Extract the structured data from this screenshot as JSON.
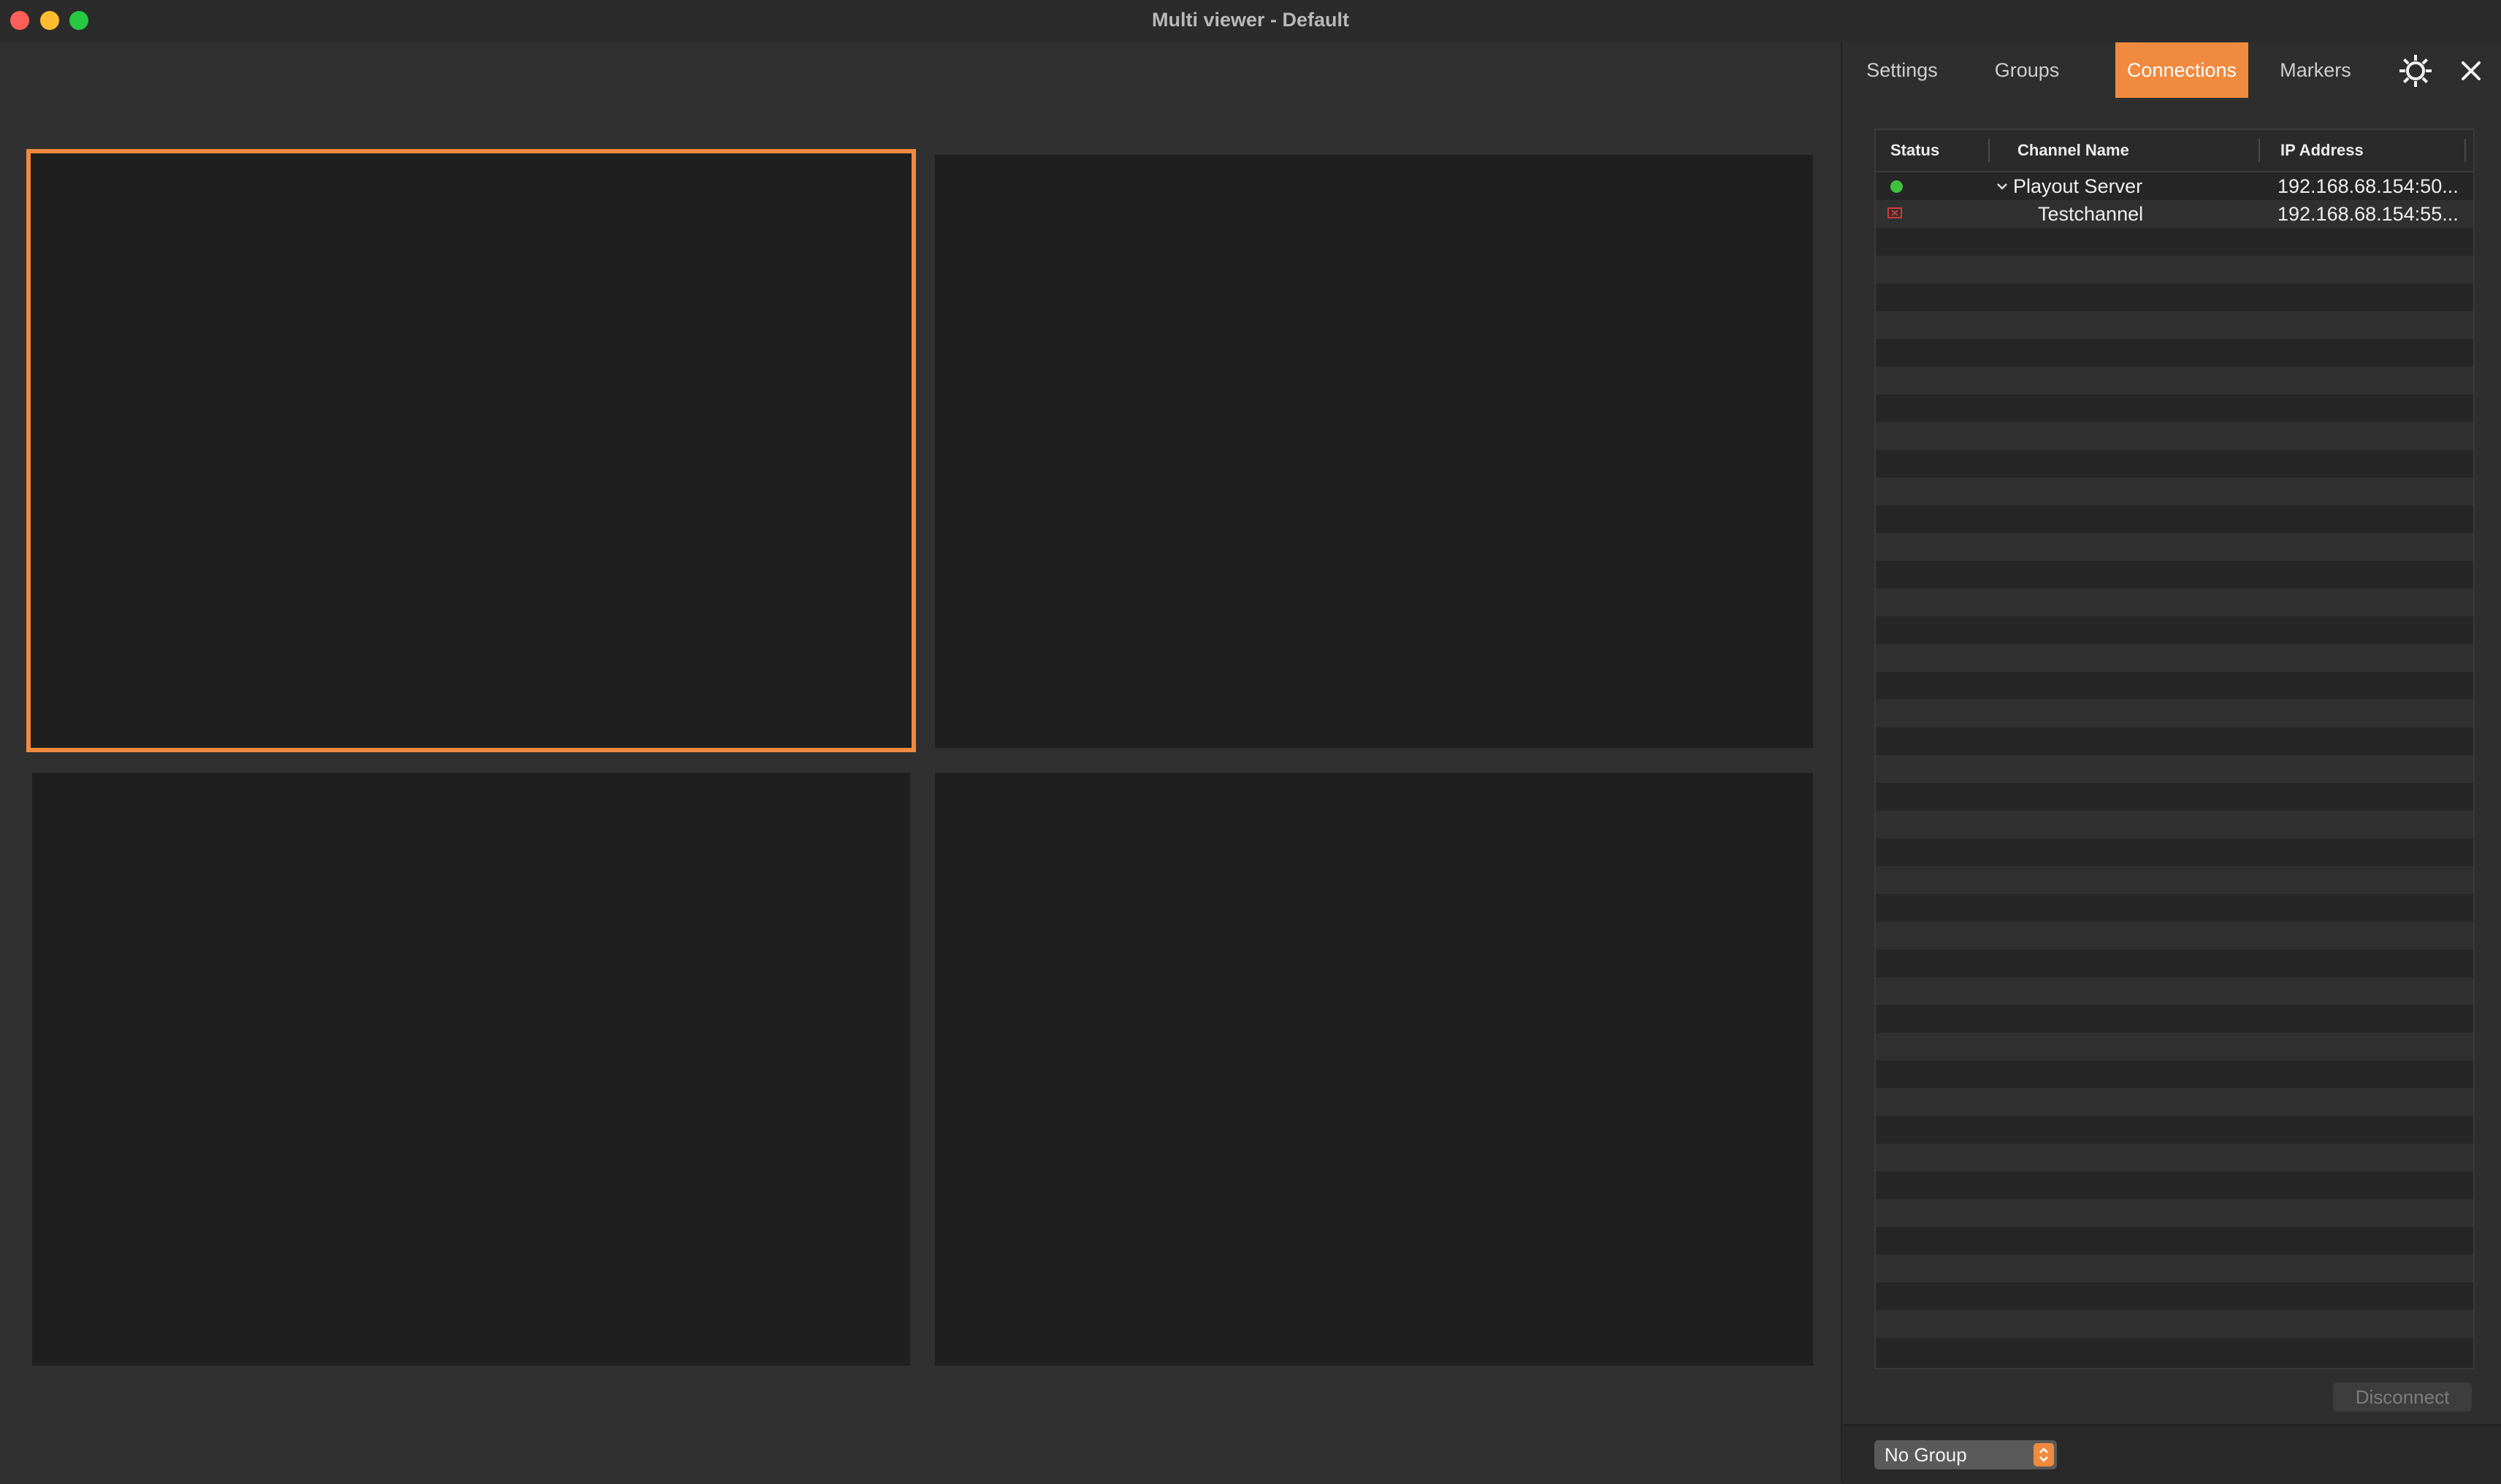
{
  "window": {
    "title": "Multi viewer - Default"
  },
  "tabs": [
    {
      "label": "Settings",
      "active": false
    },
    {
      "label": "Groups",
      "active": false
    },
    {
      "label": "Connections",
      "active": true
    },
    {
      "label": "Markers",
      "active": false
    }
  ],
  "toolbar": {
    "settings_icon": "gear-icon",
    "close_icon": "close-icon"
  },
  "table": {
    "columns": [
      "Status",
      "Channel Name",
      "IP Address"
    ],
    "rows": [
      {
        "status": "connected",
        "channel": "Playout Server",
        "ip": "192.168.68.154:50...",
        "expanded": true
      },
      {
        "status": "error",
        "channel": "Testchannel",
        "ip": "192.168.68.154:55..."
      }
    ]
  },
  "actions": {
    "disconnect_label": "Disconnect"
  },
  "group_select": {
    "value": "No Group"
  },
  "colors": {
    "accent": "#f08a3e",
    "status_ok": "#3ec13e",
    "status_error": "#d23a3a"
  }
}
